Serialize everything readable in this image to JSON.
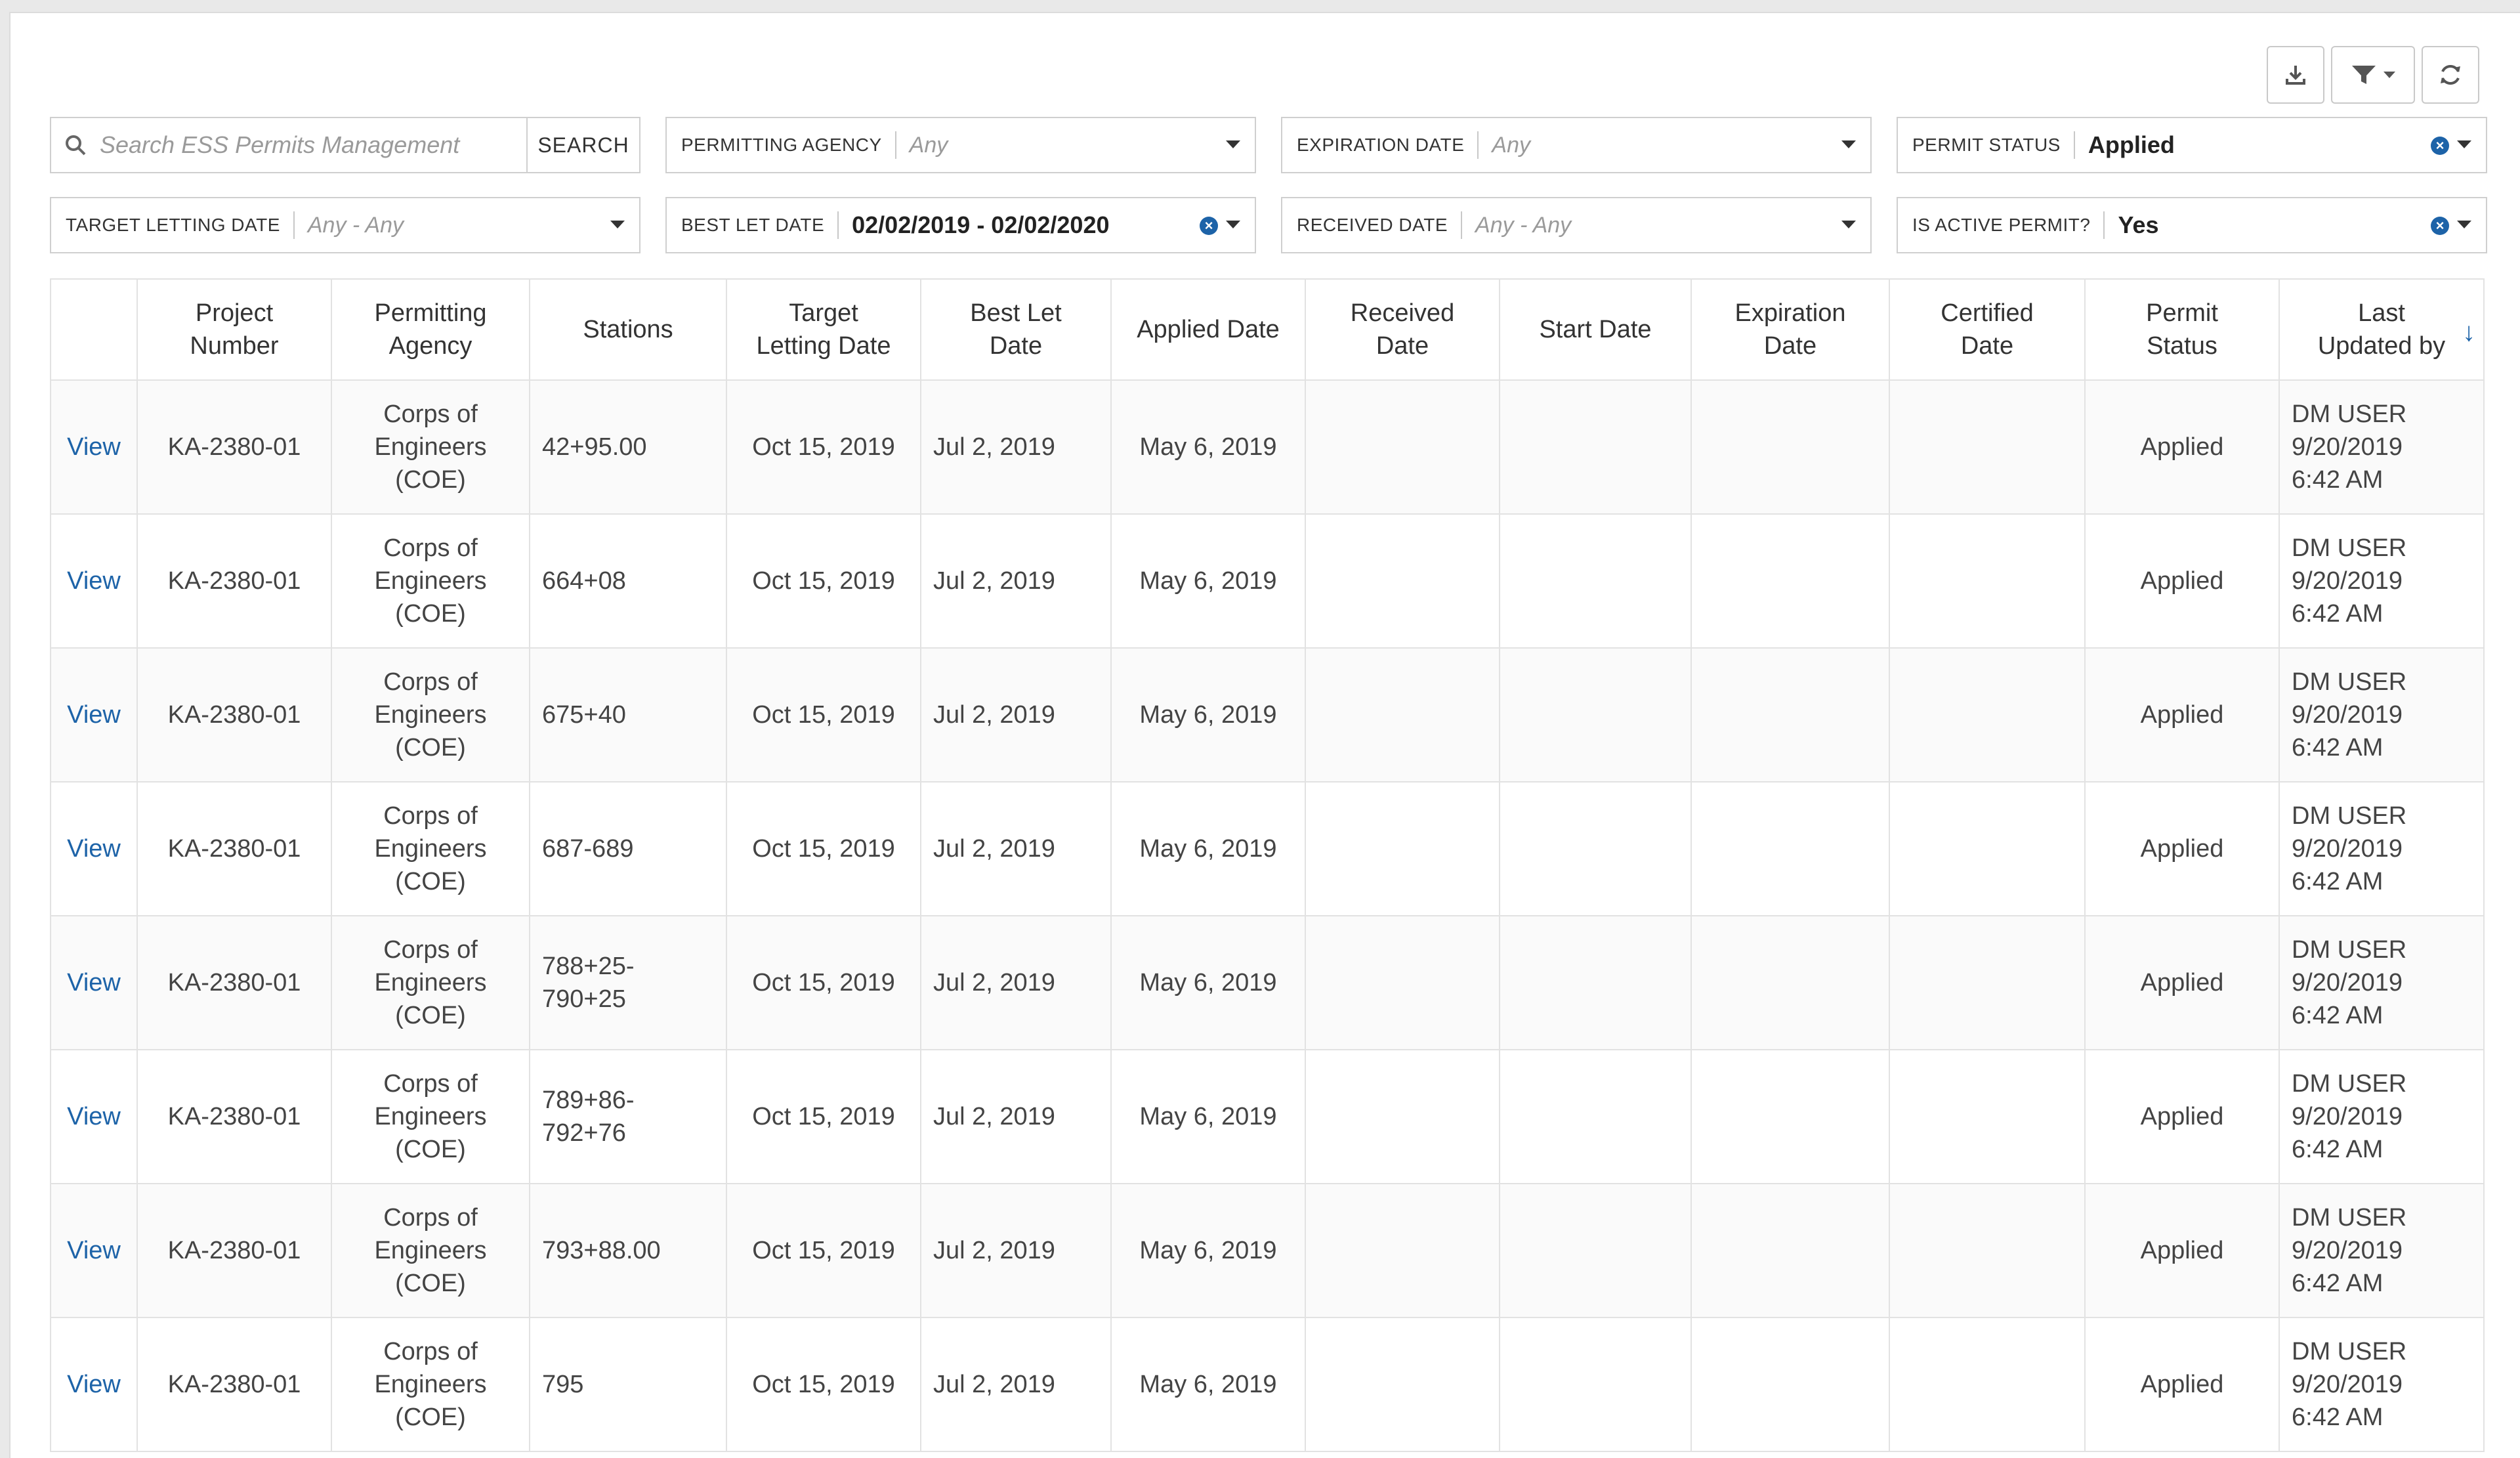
{
  "toolbar": {
    "download_icon": "download-icon",
    "filter_icon": "filter-icon",
    "refresh_icon": "refresh-icon"
  },
  "search": {
    "placeholder": "Search ESS Permits Management",
    "button_label": "SEARCH"
  },
  "filters": {
    "permitting_agency": {
      "label": "PERMITTING AGENCY",
      "value": "Any"
    },
    "expiration_date": {
      "label": "EXPIRATION DATE",
      "value": "Any"
    },
    "permit_status": {
      "label": "PERMIT STATUS",
      "value": "Applied"
    },
    "target_letting_date": {
      "label": "TARGET LETTING DATE",
      "value": "Any - Any"
    },
    "best_let_date": {
      "label": "BEST LET DATE",
      "value": "02/02/2019 - 02/02/2020"
    },
    "received_date": {
      "label": "RECEIVED DATE",
      "value": "Any - Any"
    },
    "is_active_permit": {
      "label": "IS ACTIVE PERMIT?",
      "value": "Yes"
    }
  },
  "table": {
    "columns": [
      [
        "",
        ""
      ],
      [
        "Project",
        "Number"
      ],
      [
        "Permitting",
        "Agency"
      ],
      [
        "Stations",
        ""
      ],
      [
        "Target",
        "Letting Date"
      ],
      [
        "Best Let",
        "Date"
      ],
      [
        "Applied Date",
        ""
      ],
      [
        "Received",
        "Date"
      ],
      [
        "Start Date",
        ""
      ],
      [
        "Expiration",
        "Date"
      ],
      [
        "Certified",
        "Date"
      ],
      [
        "Permit",
        "Status"
      ],
      [
        "Last",
        "Updated by"
      ]
    ],
    "rows": [
      {
        "action": "View",
        "project": "KA-2380-01",
        "agency": [
          "Corps of",
          "Engineers",
          "(COE)"
        ],
        "stations": [
          "42+95.00"
        ],
        "target": "Oct 15, 2019",
        "best_let": "Jul 2, 2019",
        "applied": "May 6, 2019",
        "received": "",
        "start": "",
        "expiration": "",
        "certified": "",
        "status": "Applied",
        "updated": [
          "DM USER",
          "9/20/2019",
          "6:42 AM"
        ]
      },
      {
        "action": "View",
        "project": "KA-2380-01",
        "agency": [
          "Corps of",
          "Engineers",
          "(COE)"
        ],
        "stations": [
          "664+08"
        ],
        "target": "Oct 15, 2019",
        "best_let": "Jul 2, 2019",
        "applied": "May 6, 2019",
        "received": "",
        "start": "",
        "expiration": "",
        "certified": "",
        "status": "Applied",
        "updated": [
          "DM USER",
          "9/20/2019",
          "6:42 AM"
        ]
      },
      {
        "action": "View",
        "project": "KA-2380-01",
        "agency": [
          "Corps of",
          "Engineers",
          "(COE)"
        ],
        "stations": [
          "675+40"
        ],
        "target": "Oct 15, 2019",
        "best_let": "Jul 2, 2019",
        "applied": "May 6, 2019",
        "received": "",
        "start": "",
        "expiration": "",
        "certified": "",
        "status": "Applied",
        "updated": [
          "DM USER",
          "9/20/2019",
          "6:42 AM"
        ]
      },
      {
        "action": "View",
        "project": "KA-2380-01",
        "agency": [
          "Corps of",
          "Engineers",
          "(COE)"
        ],
        "stations": [
          "687-689"
        ],
        "target": "Oct 15, 2019",
        "best_let": "Jul 2, 2019",
        "applied": "May 6, 2019",
        "received": "",
        "start": "",
        "expiration": "",
        "certified": "",
        "status": "Applied",
        "updated": [
          "DM USER",
          "9/20/2019",
          "6:42 AM"
        ]
      },
      {
        "action": "View",
        "project": "KA-2380-01",
        "agency": [
          "Corps of",
          "Engineers",
          "(COE)"
        ],
        "stations": [
          "788+25-",
          "790+25"
        ],
        "target": "Oct 15, 2019",
        "best_let": "Jul 2, 2019",
        "applied": "May 6, 2019",
        "received": "",
        "start": "",
        "expiration": "",
        "certified": "",
        "status": "Applied",
        "updated": [
          "DM USER",
          "9/20/2019",
          "6:42 AM"
        ]
      },
      {
        "action": "View",
        "project": "KA-2380-01",
        "agency": [
          "Corps of",
          "Engineers",
          "(COE)"
        ],
        "stations": [
          "789+86-",
          "792+76"
        ],
        "target": "Oct 15, 2019",
        "best_let": "Jul 2, 2019",
        "applied": "May 6, 2019",
        "received": "",
        "start": "",
        "expiration": "",
        "certified": "",
        "status": "Applied",
        "updated": [
          "DM USER",
          "9/20/2019",
          "6:42 AM"
        ]
      },
      {
        "action": "View",
        "project": "KA-2380-01",
        "agency": [
          "Corps of",
          "Engineers",
          "(COE)"
        ],
        "stations": [
          "793+88.00"
        ],
        "target": "Oct 15, 2019",
        "best_let": "Jul 2, 2019",
        "applied": "May 6, 2019",
        "received": "",
        "start": "",
        "expiration": "",
        "certified": "",
        "status": "Applied",
        "updated": [
          "DM USER",
          "9/20/2019",
          "6:42 AM"
        ]
      },
      {
        "action": "View",
        "project": "KA-2380-01",
        "agency": [
          "Corps of",
          "Engineers",
          "(COE)"
        ],
        "stations": [
          "795"
        ],
        "target": "Oct 15, 2019",
        "best_let": "Jul 2, 2019",
        "applied": "May 6, 2019",
        "received": "",
        "start": "",
        "expiration": "",
        "certified": "",
        "status": "Applied",
        "updated": [
          "DM USER",
          "9/20/2019",
          "6:42 AM"
        ]
      }
    ]
  },
  "colors": {
    "accent": "#1d63a8",
    "border": "#cfcfcf",
    "text": "#333333"
  }
}
